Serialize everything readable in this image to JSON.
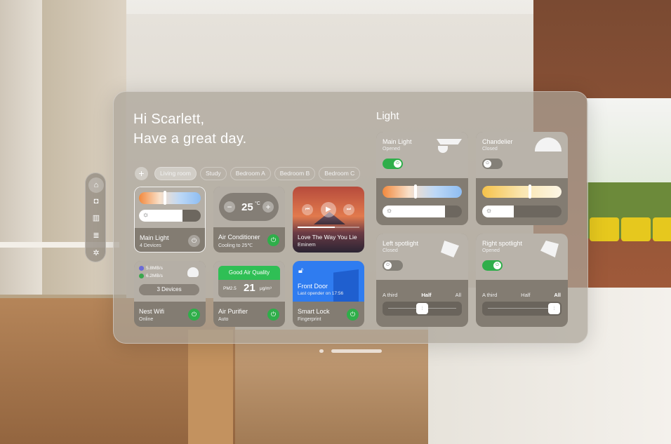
{
  "greeting": {
    "line1": "Hi Scarlett,",
    "line2": "Have a great day."
  },
  "rooms": {
    "add_label": "+",
    "tabs": [
      {
        "label": "Living room",
        "active": true
      },
      {
        "label": "Study",
        "active": false
      },
      {
        "label": "Bedroom A",
        "active": false
      },
      {
        "label": "Bedroom B",
        "active": false
      },
      {
        "label": "Bedroom C",
        "active": false
      }
    ]
  },
  "sidebar": {
    "items": [
      "home-icon",
      "camera-icon",
      "door-icon",
      "storage-icon",
      "settings-icon"
    ],
    "active_index": 0
  },
  "cards": {
    "main_light": {
      "title": "Main Light",
      "subtitle": "4 Devices",
      "color_temp": 0.42,
      "brightness": 0.7,
      "on": false
    },
    "air_conditioner": {
      "title": "Air Conditioner",
      "subtitle": "Cooling to 25℃",
      "temp_value": "25",
      "temp_unit": "°C",
      "minus": "−",
      "plus": "+",
      "on": true
    },
    "music": {
      "song": "Love The Way You Lie",
      "artist": "Eminem",
      "progress": 0.6
    },
    "nest_wifi": {
      "title": "Nest Wifi",
      "subtitle": "Online",
      "up_speed": "5.8MB/s",
      "down_speed": "6.2MB/s",
      "devices_label": "3 Devices",
      "on": true
    },
    "air_purifier": {
      "title": "Air Purifier",
      "subtitle": "Auto",
      "quality_label": "Good Air Quality",
      "pm_label": "PM2.5",
      "pm_value": "21",
      "pm_unit": "μg/m³",
      "on": true
    },
    "smart_lock": {
      "title": "Smart Lock",
      "subtitle": "Fingerprint",
      "door_label": "Front Door",
      "last_opened": "Last opender on 17:56",
      "on": true
    }
  },
  "light": {
    "title": "Light",
    "main_light": {
      "title": "Main Light",
      "status": "Opened",
      "on": true,
      "color_temp": 0.42,
      "brightness": 0.79
    },
    "chandelier": {
      "title": "Chandelier",
      "status": "Closed",
      "on": false,
      "color_temp": 0.6,
      "brightness": 0.4
    },
    "left_spotlight": {
      "title": "Left spotlight",
      "status": "Closed",
      "on": false,
      "segments": [
        "A third",
        "Half",
        "All"
      ],
      "selected": 1,
      "level": 0.5
    },
    "right_spotlight": {
      "title": "Right spotlight",
      "status": "Opened",
      "on": true,
      "segments": [
        "A third",
        "Half",
        "All"
      ],
      "selected": 2,
      "level": 0.98
    }
  },
  "colors": {
    "accent_green": "#2fae4a",
    "lock_blue": "#2f7cf0",
    "quality_green": "#2fbf55"
  }
}
